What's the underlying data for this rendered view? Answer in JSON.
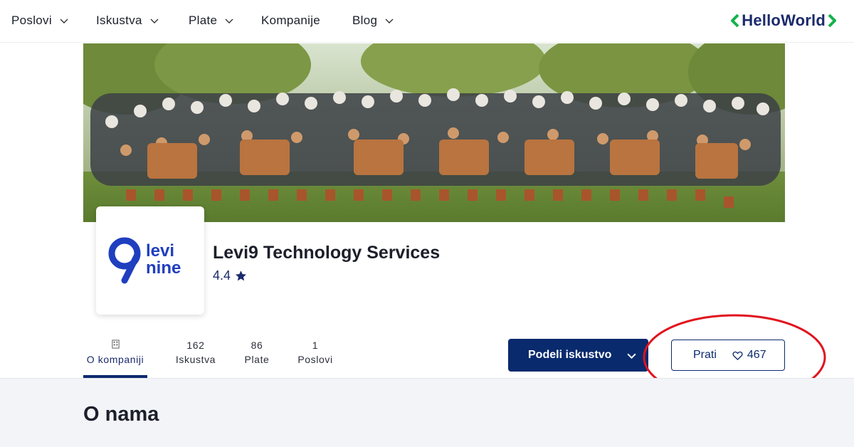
{
  "nav": {
    "items": [
      {
        "label": "Poslovi",
        "has_dropdown": true
      },
      {
        "label": "Iskustva",
        "has_dropdown": true
      },
      {
        "label": "Plate",
        "has_dropdown": true
      },
      {
        "label": "Kompanije",
        "has_dropdown": false
      },
      {
        "label": "Blog",
        "has_dropdown": true
      }
    ],
    "logo": {
      "prefix": "Hello",
      "suffix": "World"
    }
  },
  "cover": {
    "icon": "group-photo"
  },
  "company": {
    "logo": {
      "numeral": "9",
      "line1": "levi",
      "line2": "nine"
    },
    "name": "Levi9 Technology Services",
    "rating": "4.4",
    "rating_icon": "star-icon"
  },
  "tabs": [
    {
      "count": "",
      "label": "O kompaniji",
      "active": true,
      "icon": "building-icon"
    },
    {
      "count": "162",
      "label": "Iskustva",
      "active": false
    },
    {
      "count": "86",
      "label": "Plate",
      "active": false
    },
    {
      "count": "1",
      "label": "Poslovi",
      "active": false
    }
  ],
  "actions": {
    "share_label": "Podeli iskustvo",
    "follow_label": "Prati",
    "follow_count": "467"
  },
  "colors": {
    "primary": "#0a2a6e",
    "brand_green": "#12b34a",
    "annotation": "#e0141e",
    "section_bg": "#f3f4f8"
  },
  "about": {
    "title": "O nama"
  }
}
